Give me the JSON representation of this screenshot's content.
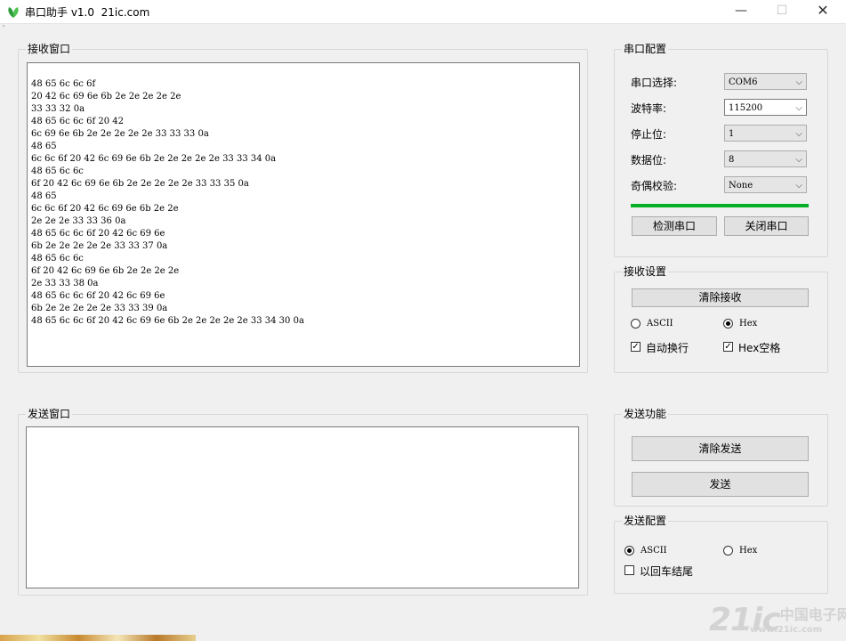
{
  "window": {
    "title": "串口助手 v1.0  21ic.com",
    "minimize": "—",
    "maximize": "☐",
    "close": "✕",
    "corner_mark": "'"
  },
  "receive_window": {
    "title": "接收窗口",
    "lines": [
      "48 65 6c 6c 6f",
      "20 42 6c 69 6e 6b 2e 2e 2e 2e 2e",
      "33 33 32 0a",
      "48 65 6c 6c 6f 20 42",
      "6c 69 6e 6b 2e 2e 2e 2e 2e 33 33 33 0a",
      "48 65",
      "6c 6c 6f 20 42 6c 69 6e 6b 2e 2e 2e 2e 2e 33 33 34 0a",
      "48 65 6c 6c",
      "6f 20 42 6c 69 6e 6b 2e 2e 2e 2e 2e 33 33 35 0a",
      "48 65",
      "6c 6c 6f 20 42 6c 69 6e 6b 2e 2e",
      "2e 2e 2e 33 33 36 0a",
      "48 65 6c 6c 6f 20 42 6c 69 6e",
      "6b 2e 2e 2e 2e 2e 33 33 37 0a",
      "48 65 6c 6c",
      "6f 20 42 6c 69 6e 6b 2e 2e 2e 2e",
      "2e 33 33 38 0a",
      "48 65 6c 6c 6f 20 42 6c 69 6e",
      "6b 2e 2e 2e 2e 2e 33 33 39 0a",
      "48 65 6c 6c 6f 20 42 6c 69 6e 6b 2e 2e 2e 2e 2e 33 34 30 0a"
    ]
  },
  "send_window": {
    "title": "发送窗口",
    "value": ""
  },
  "serial_config": {
    "title": "串口配置",
    "port_label": "串口选择:",
    "port_value": "COM6",
    "baud_label": "波特率:",
    "baud_value": "115200",
    "stop_label": "停止位:",
    "stop_value": "1",
    "data_label": "数据位:",
    "data_value": "8",
    "parity_label": "奇偶校验:",
    "parity_value": "None",
    "progress": 1.0,
    "progress_color": "#06b025",
    "detect_button": "检测串口",
    "close_button": "关闭串口"
  },
  "receive_settings": {
    "title": "接收设置",
    "clear_button": "清除接收",
    "ascii_label": "ASCII",
    "hex_label": "Hex",
    "mode_selected": "Hex",
    "auto_newline_label": "自动换行",
    "auto_newline_checked": true,
    "hex_space_label": "Hex空格",
    "hex_space_checked": true
  },
  "send_function": {
    "title": "发送功能",
    "clear_button": "清除发送",
    "send_button": "发送"
  },
  "send_config": {
    "title": "发送配置",
    "ascii_label": "ASCII",
    "hex_label": "Hex",
    "mode_selected": "ASCII",
    "crlf_label": "以回车结尾",
    "crlf_checked": false
  },
  "watermark": {
    "brand": "21ic",
    "cn": "中国电子网",
    "url": "www.21ic.com"
  }
}
